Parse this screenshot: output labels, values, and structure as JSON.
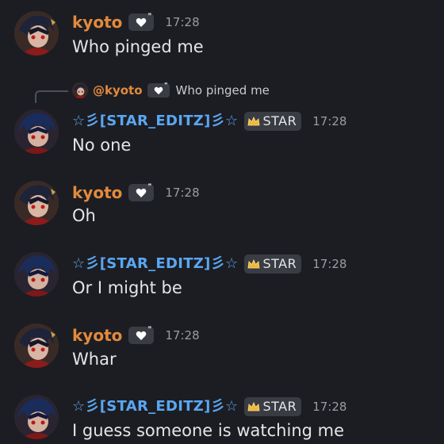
{
  "colors": {
    "background": "#1c1d22",
    "kyoto_name": "#e28a3d",
    "star_name": "#5aa7f2",
    "timestamp": "#9a9ca3",
    "message_text": "#e4e5e8",
    "badge_bg": "#3a3c43"
  },
  "icons": {
    "heart_badge": "white-heart-icon",
    "star_badge": "crown-icon",
    "reply_connector": "reply-connector-line"
  },
  "reply": {
    "author": "@kyoto",
    "text": "Who pinged me"
  },
  "messages": [
    {
      "author": "kyoto",
      "tag": "",
      "time": "17:28",
      "text": "Who pinged me"
    },
    {
      "author": "☆彡[STAR_EDITZ]彡☆",
      "tag": "STAR",
      "time": "17:28",
      "text": "No one"
    },
    {
      "author": "kyoto",
      "tag": "",
      "time": "17:28",
      "text": "Oh"
    },
    {
      "author": "☆彡[STAR_EDITZ]彡☆",
      "tag": "STAR",
      "time": "17:28",
      "text": "Or I might be"
    },
    {
      "author": "kyoto",
      "tag": "",
      "time": "17:28",
      "text": "Whar"
    },
    {
      "author": "☆彡[STAR_EDITZ]彡☆",
      "tag": "STAR",
      "time": "17:28",
      "text": "I guess someone is watching me"
    }
  ]
}
